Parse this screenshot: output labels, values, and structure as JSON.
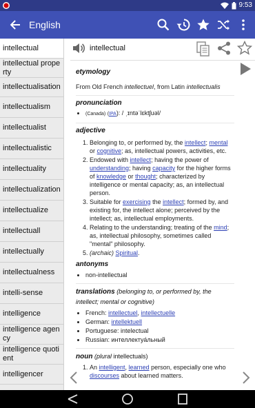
{
  "status": {
    "time": "9:53"
  },
  "appbar": {
    "title": "English"
  },
  "icons": {
    "back": "arrow-back-icon",
    "search": "search-icon",
    "history": "history-icon",
    "favorite": "star-icon",
    "shuffle": "shuffle-icon",
    "menu": "more-vert-icon",
    "speaker": "speaker-icon",
    "copy": "copy-icon",
    "share": "share-icon",
    "play": "play-icon",
    "prev": "chevron-left-icon",
    "next": "chevron-right-icon"
  },
  "colors": {
    "appbar": "#3f51b5",
    "statusbar": "#2e3a87",
    "link": "#2b3fb5"
  },
  "words": [
    "intellectual",
    "intellectual property",
    "intellectualisation",
    "intellectualism",
    "intellectualist",
    "intellectualistic",
    "intellectuality",
    "intellectualization",
    "intellectualize",
    "intellectuall",
    "intellectually",
    "intellectualness",
    "intelli-sense",
    "intelligence",
    "intelligence agency",
    "intelligence quotient",
    "intelligencer"
  ],
  "entry": {
    "headword": "intellectual",
    "etymology": {
      "heading": "etymology",
      "t1": "From Old French ",
      "t2": "intellectuel",
      "t3": ", from Latin ",
      "t4": "intellectualis"
    },
    "pronunciation": {
      "heading": "pronunciation",
      "region": "(Canada)",
      "ipa_link": "IPA",
      "ipa_text": "): / ˌɪntəˈlɛktʃuəl/"
    },
    "adjective": {
      "heading": "adjective",
      "d1a": "Belonging to, or performed by, the ",
      "d1b": "intellect",
      "d1c": "; ",
      "d1d": "mental",
      "d1e": " or ",
      "d1f": "cognitive",
      "d1g": "; as, intellectual powers, activities, etc.",
      "d2a": "Endowed with ",
      "d2b": "intellect",
      "d2c": "; having the power of ",
      "d2d": "understanding",
      "d2e": "; having ",
      "d2f": "capacity",
      "d2g": " for the higher forms of ",
      "d2h": "knowledge",
      "d2i": " or ",
      "d2j": "thought",
      "d2k": "; characterized by intelligence or mental capacity; as, an intellectual person.",
      "d3a": "Suitable for ",
      "d3b": "exercising",
      "d3c": " the ",
      "d3d": "intellect",
      "d3e": "; formed by, and existing for, the intellect alone; perceived by the intellect; as, intellectual employments.",
      "d4a": "Relating to the understanding; treating of the ",
      "d4b": "mind",
      "d4c": "; as, intellectual philosophy, sometimes called \"mental\" philosophy.",
      "d5a": "(archaic) ",
      "d5b": "Spiritual",
      "d5c": "."
    },
    "antonyms": {
      "heading": "antonyms",
      "item": "non-intellectual"
    },
    "translations": {
      "heading": "translations",
      "note": " (belonging to, or performed by, the intellect; mental or cognitive)",
      "fr_label": "French: ",
      "fr1": "intellectuel",
      "fr_sep": ", ",
      "fr2": "intellectuelle",
      "de_label": "German: ",
      "de1": "intellektuell",
      "pt_label": "Portuguese: intelectual",
      "ru_label": "Russian: интеллектуа́льный"
    },
    "noun": {
      "heading": "noun",
      "note_a": " (",
      "note_b": "plural",
      "note_c": " intellectuals)",
      "d1a": "An ",
      "d1b": "intelligent",
      "d1c": ", ",
      "d1d": "learned",
      "d1e": " person, especially one who ",
      "d1f": "discourses",
      "d1g": " about learned matters."
    }
  }
}
